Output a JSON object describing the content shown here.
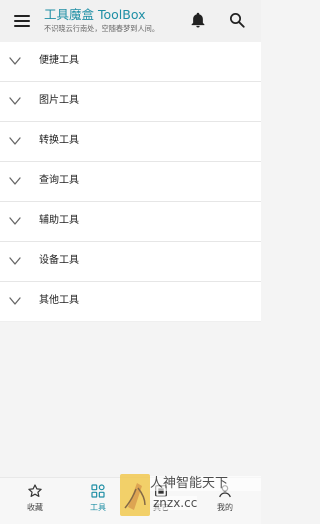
{
  "header": {
    "title": "工具魔盒 ToolBox",
    "subtitle": "不识晓云行南处，空随春梦到人间。",
    "menu_icon": "menu-icon",
    "bell_icon": "bell-icon",
    "search_icon": "search-icon",
    "accent_color": "#1f8fa5"
  },
  "categories": [
    {
      "label": "便捷工具",
      "icon": "chevron-down-icon"
    },
    {
      "label": "图片工具",
      "icon": "chevron-down-icon"
    },
    {
      "label": "转换工具",
      "icon": "chevron-down-icon"
    },
    {
      "label": "查询工具",
      "icon": "chevron-down-icon"
    },
    {
      "label": "辅助工具",
      "icon": "chevron-down-icon"
    },
    {
      "label": "设备工具",
      "icon": "chevron-down-icon"
    },
    {
      "label": "其他工具",
      "icon": "chevron-down-icon"
    }
  ],
  "bottom_nav": [
    {
      "label": "收藏",
      "icon": "star-icon",
      "active": false
    },
    {
      "label": "工具",
      "icon": "grid-icon",
      "active": true
    },
    {
      "label": "其它",
      "icon": "other-icon",
      "active": false
    },
    {
      "label": "我的",
      "icon": "profile-icon",
      "active": false
    }
  ],
  "watermark": {
    "line1": "人神智能天下",
    "line2": "znzx.cc"
  }
}
